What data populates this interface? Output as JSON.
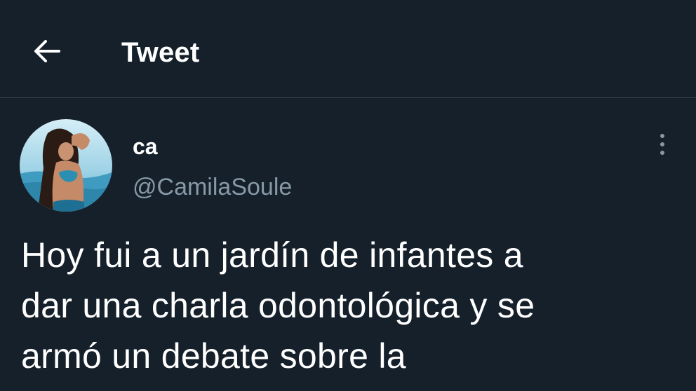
{
  "header": {
    "back_icon": "arrow-left-icon",
    "title": "Tweet"
  },
  "tweet": {
    "author": {
      "display_name": "ca",
      "handle": "@CamilaSoule",
      "avatar": "profile-photo"
    },
    "more_icon": "more-vertical-icon",
    "text": "Hoy fui a un jardín de infantes a\ndar una charla odontológica y se\narmó un debate sobre la"
  },
  "colors": {
    "background": "#15202b",
    "primary_text": "#ffffff",
    "secondary_text": "#8899a6",
    "divider": "#38444d"
  }
}
